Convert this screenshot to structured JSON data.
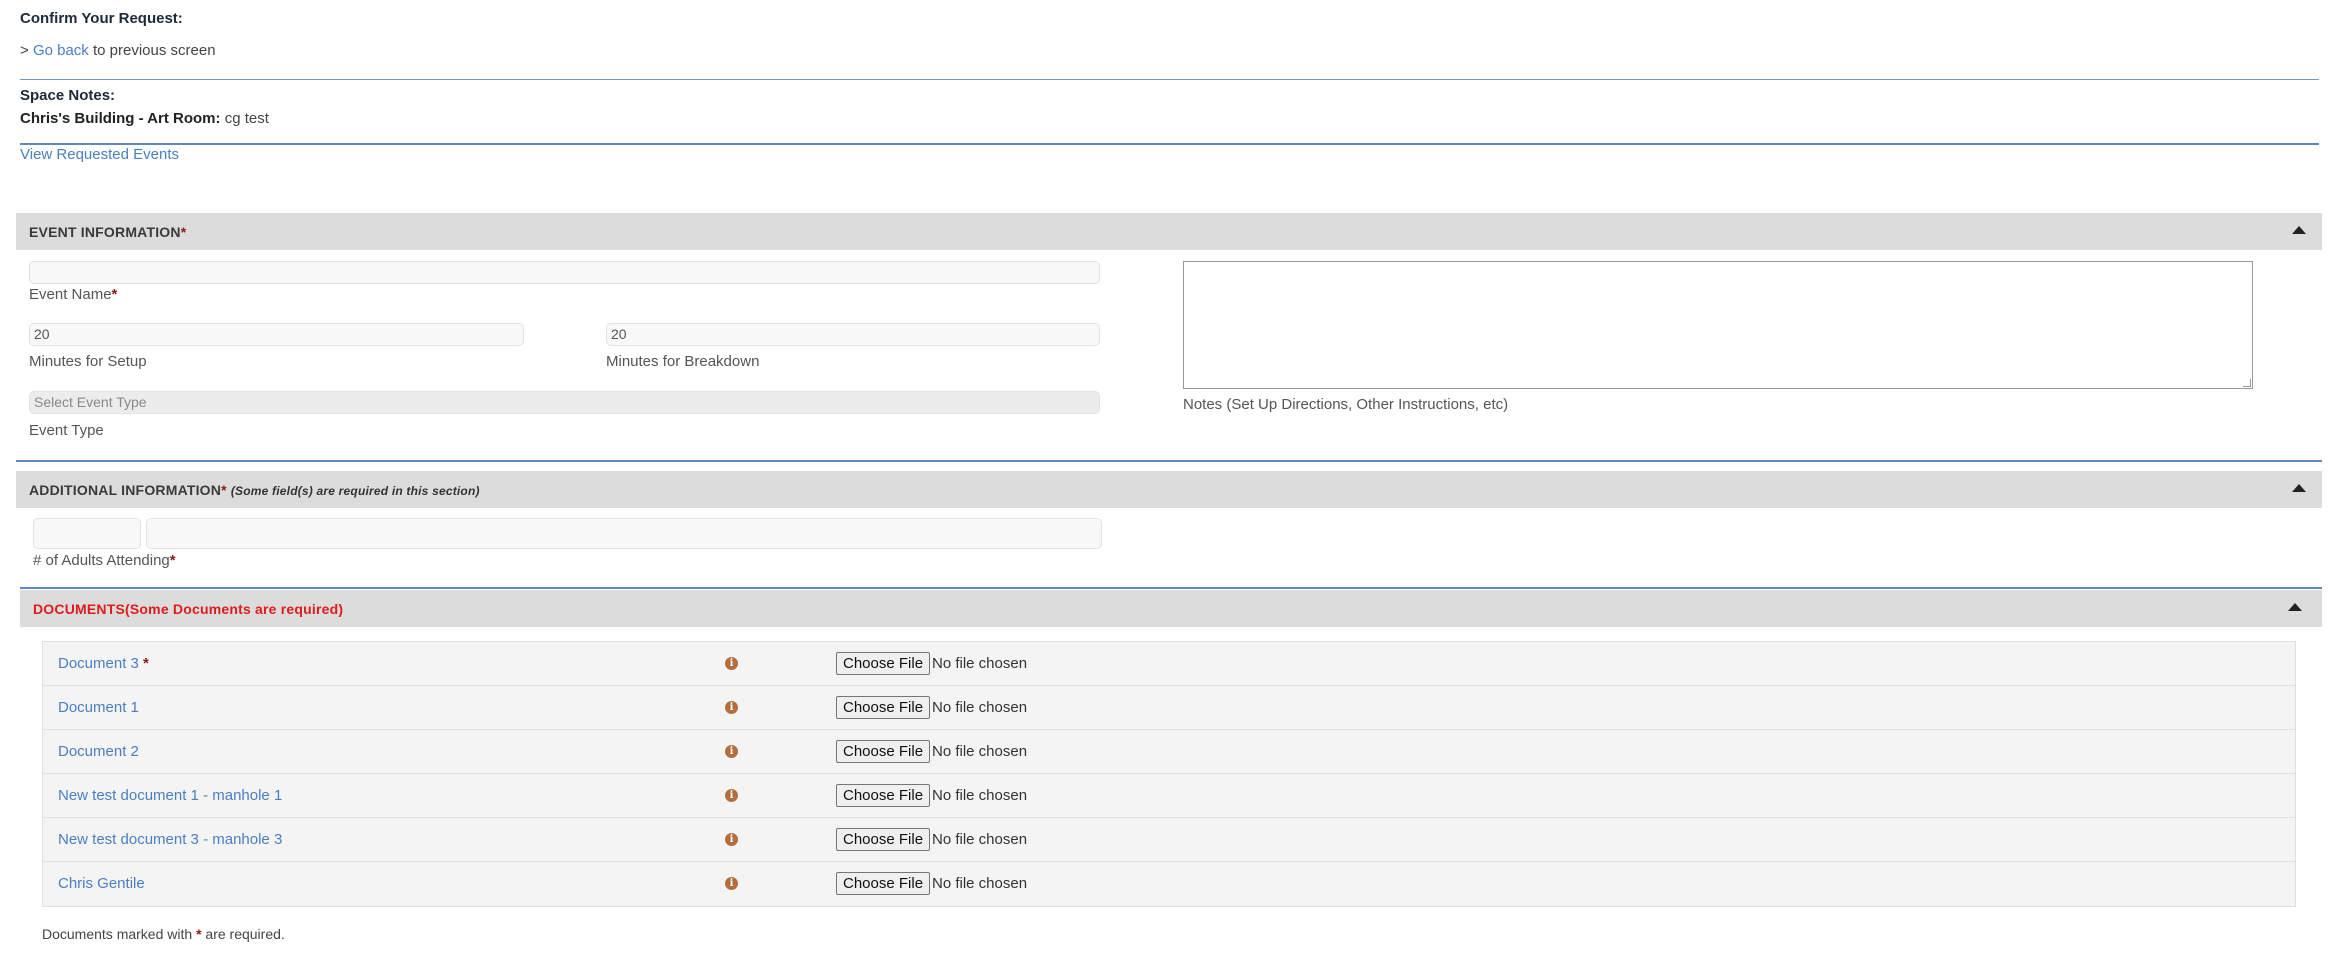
{
  "header": {
    "confirm_title": "Confirm Your Request:",
    "go_back_prefix": ">",
    "go_back_link": "Go back",
    "go_back_suffix": "to previous screen"
  },
  "space_notes": {
    "title": "Space Notes:",
    "location": "Chris's Building - Art Room:",
    "note": "cg test"
  },
  "view_requested_events": "View Requested Events",
  "event_information": {
    "title": "EVENT INFORMATION",
    "required_mark": "*",
    "event_name_value": "",
    "event_name_label": "Event Name",
    "setup_value": "20",
    "setup_label": "Minutes for Setup",
    "breakdown_value": "20",
    "breakdown_label": "Minutes for Breakdown",
    "event_type_placeholder": "Select Event Type",
    "event_type_label": "Event Type",
    "notes_value": "",
    "notes_label": "Notes (Set Up Directions, Other Instructions, etc)",
    "collapse_icon": "caret-up-icon"
  },
  "additional_information": {
    "title": "ADDITIONAL INFORMATION",
    "required_mark": "*",
    "subtitle": "(Some field(s) are required in this section)",
    "adults_label": "# of Adults Attending",
    "adults_value": "",
    "adults_extra_value": "",
    "collapse_icon": "caret-up-icon"
  },
  "documents": {
    "title": "DOCUMENTS(Some Documents are required)",
    "title_color": "#e01b1b",
    "choose_file_label": "Choose File",
    "no_file_label": "No file chosen",
    "info_icon": "info-circle-icon",
    "items": [
      {
        "name": "Document 3",
        "required": "*"
      },
      {
        "name": "Document 1",
        "required": ""
      },
      {
        "name": "Document 2",
        "required": ""
      },
      {
        "name": "New test document 1 - manhole 1",
        "required": ""
      },
      {
        "name": "New test document 3 - manhole 3",
        "required": ""
      },
      {
        "name": "Chris Gentile",
        "required": ""
      }
    ],
    "footer_prefix": "Documents marked with",
    "footer_mark": "*",
    "footer_suffix": "are required.",
    "collapse_icon": "caret-up-icon"
  },
  "colors": {
    "link": "#4a7fc1",
    "section_bg": "#dcdcdc",
    "divider": "#5d87bd",
    "required": "#8b1a1a"
  }
}
